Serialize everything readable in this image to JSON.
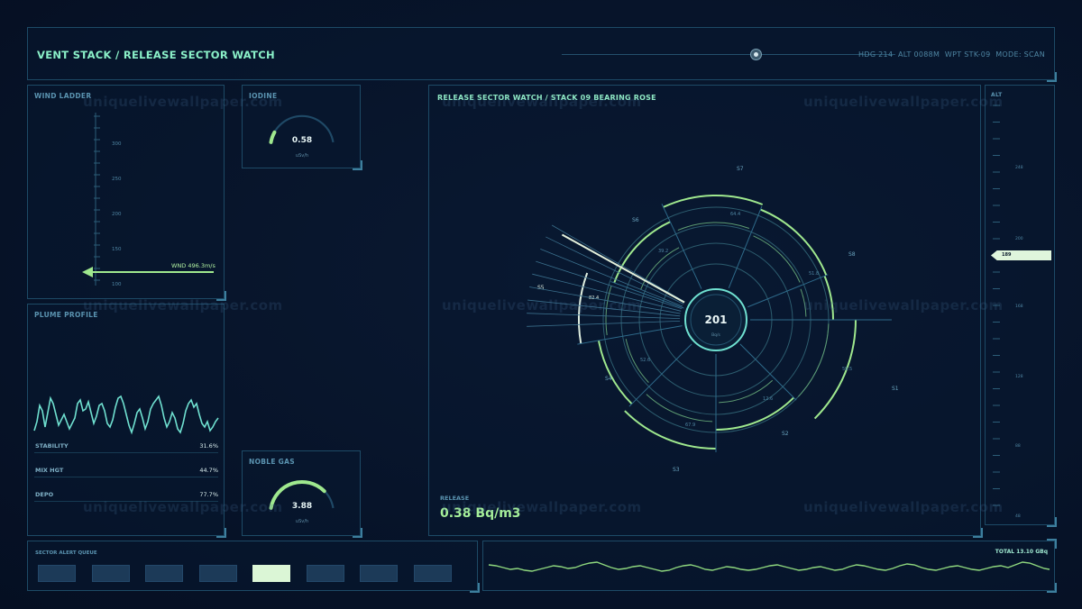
{
  "header": {
    "title": "VENT STACK / RELEASE SECTOR WATCH",
    "nav_readout": "HDG 214  ALT 0088M  WPT STK-09  MODE: SCAN"
  },
  "wind_ladder": {
    "title": "WIND LADDER",
    "ticks": [
      "300",
      "250",
      "200",
      "150",
      "100"
    ],
    "indicator": "WND 496.3m/s"
  },
  "iodine": {
    "title": "IODINE",
    "value": "0.58",
    "unit": "uSv/h",
    "level": 0.12
  },
  "noble_gas": {
    "title": "NOBLE GAS",
    "value": "3.88",
    "unit": "uSv/h",
    "level": 0.78
  },
  "plume": {
    "title": "PLUME PROFILE",
    "stats": [
      {
        "label": "STABILITY",
        "value": "31.6%"
      },
      {
        "label": "MIX HGT",
        "value": "44.7%"
      },
      {
        "label": "DEPO",
        "value": "77.7%"
      }
    ]
  },
  "rose": {
    "title": "RELEASE SECTOR WATCH / STACK 09  BEARING ROSE",
    "center_value": "201",
    "center_unit": "Bq/s",
    "sectors": [
      {
        "label": "S1",
        "value": "",
        "level": 0.95
      },
      {
        "label": "S2",
        "value": "12.6",
        "level": 0.62
      },
      {
        "label": "S3",
        "value": "67.9",
        "level": 0.83
      },
      {
        "label": "S4",
        "value": "52.6",
        "level": 0.72
      },
      {
        "label": "S5",
        "value": "82.4",
        "level": 0.92
      },
      {
        "label": "S6",
        "value": "39.2",
        "level": 0.6
      },
      {
        "label": "S7",
        "value": "64.4",
        "level": 0.78
      },
      {
        "label": "S8",
        "value": "51.8",
        "level": 0.72
      },
      {
        "label": "",
        "value": "59.5",
        "level": 0.7
      }
    ],
    "release_label": "RELEASE",
    "release_value": "0.38 Bq/m3"
  },
  "alt_ladder": {
    "title": "ALT",
    "ticks": [
      "248",
      "200",
      "168",
      "128",
      "88",
      "48"
    ],
    "marker": "189"
  },
  "alert_queue": {
    "title": "SECTOR ALERT QUEUE",
    "active_index": 4,
    "count": 8
  },
  "total": {
    "label": "TOTAL 13.10 GBq"
  },
  "colors": {
    "accent": "#9fe88e",
    "cyan": "#6fe0d0",
    "dim": "#1d4a66",
    "text": "#5a93b0"
  }
}
